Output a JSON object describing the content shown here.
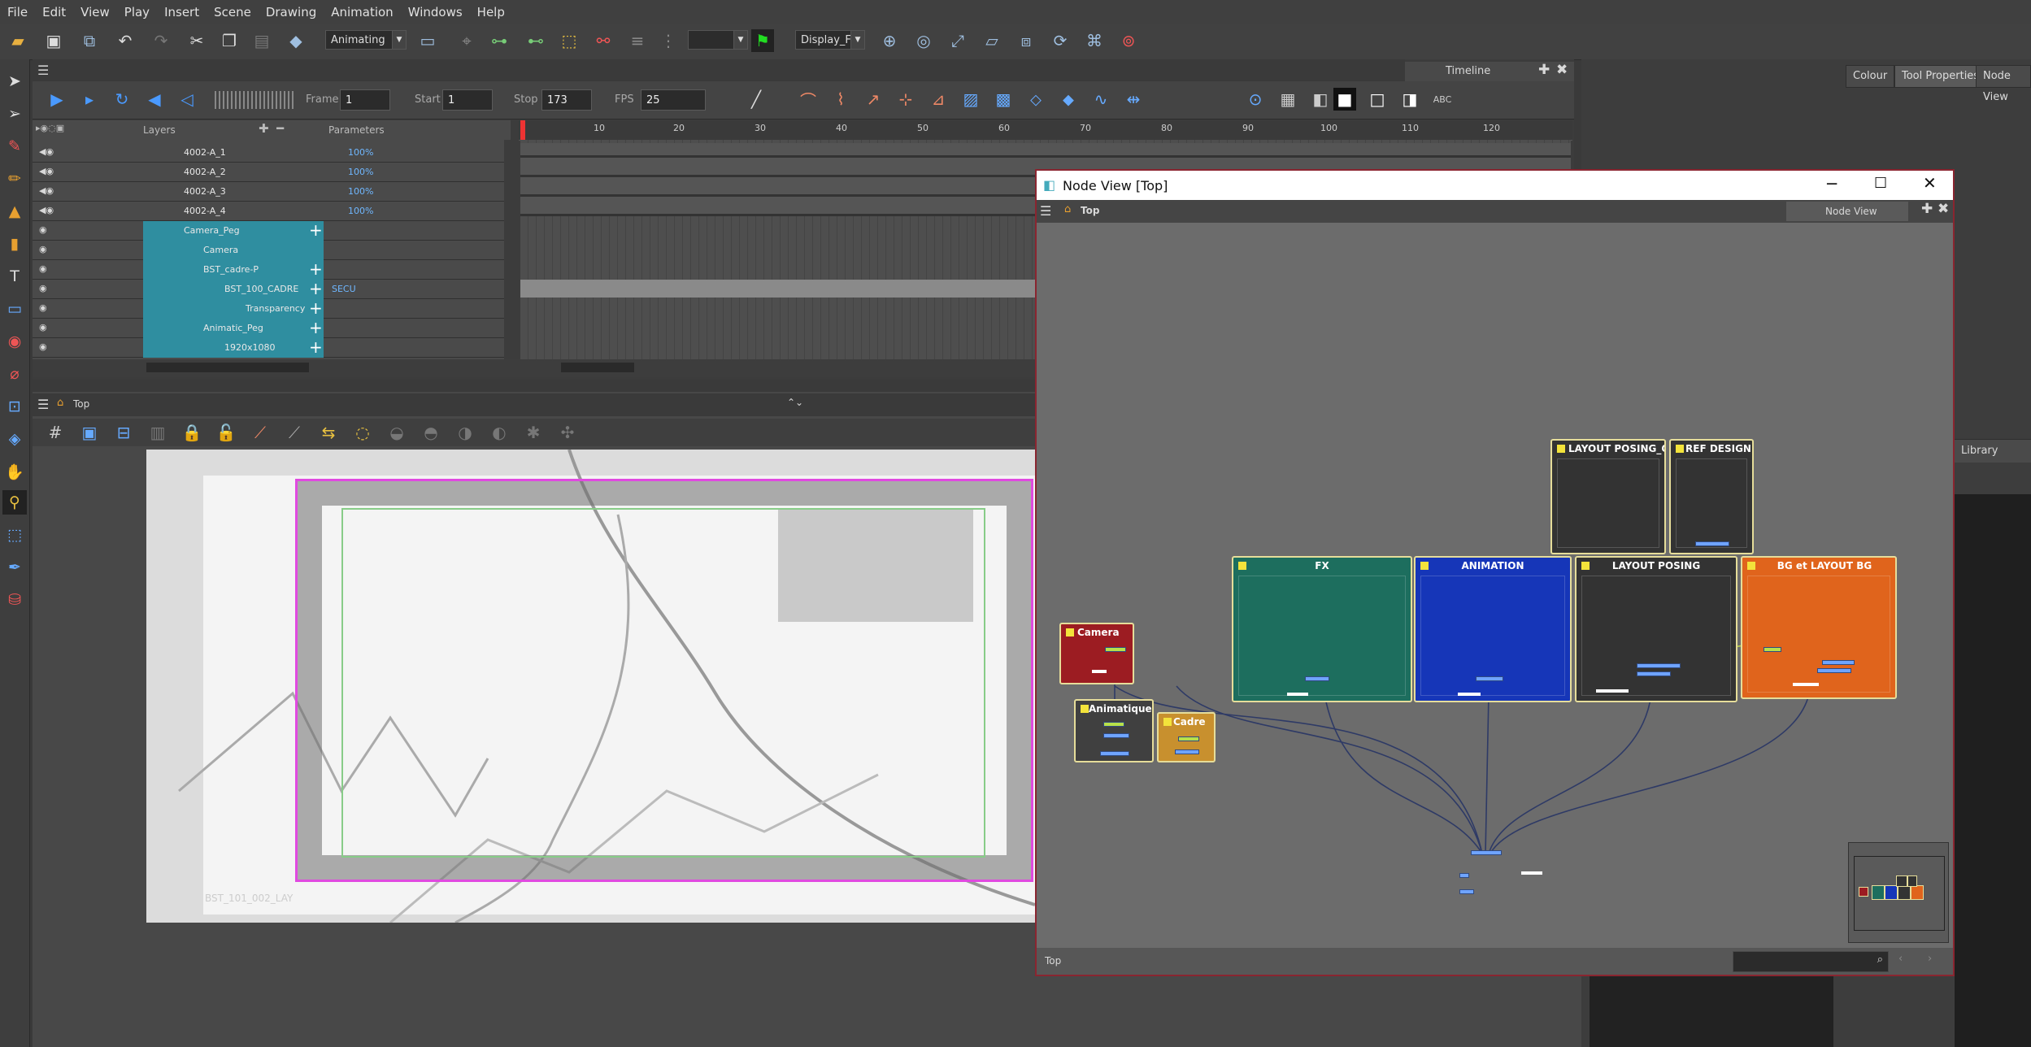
{
  "menu": [
    "File",
    "Edit",
    "View",
    "Play",
    "Insert",
    "Scene",
    "Drawing",
    "Animation",
    "Windows",
    "Help"
  ],
  "toolbar": {
    "mode_combo": "Animating",
    "display_combo": "Display_Fir"
  },
  "timeline": {
    "tab": "Timeline",
    "frame_label": "Frame",
    "frame_value": "1",
    "start_label": "Start",
    "start_value": "1",
    "stop_label": "Stop",
    "stop_value": "173",
    "fps_label": "FPS",
    "fps_value": "25",
    "layers_label": "Layers",
    "params_label": "Parameters",
    "ruler": [
      "10",
      "20",
      "30",
      "40",
      "50",
      "60",
      "70",
      "80",
      "90",
      "100",
      "110",
      "120"
    ],
    "layers": [
      {
        "name": "4002-A_1",
        "pct": "100%"
      },
      {
        "name": "4002-A_2",
        "pct": "100%"
      },
      {
        "name": "4002-A_3",
        "pct": "100%"
      },
      {
        "name": "4002-A_4",
        "pct": "100%"
      },
      {
        "name": "Camera_Peg",
        "pct": ""
      },
      {
        "name": "Camera",
        "pct": ""
      },
      {
        "name": "BST_cadre-P",
        "pct": ""
      },
      {
        "name": "BST_100_CADRE",
        "pct": "SECU"
      },
      {
        "name": "Transparency",
        "pct": ""
      },
      {
        "name": "Animatic_Peg",
        "pct": ""
      },
      {
        "name": "1920x1080",
        "pct": ""
      }
    ]
  },
  "camera_view": {
    "breadcrumb": "Top",
    "watermark": "BST_101_002_LAY"
  },
  "node_view": {
    "title": "Node View [Top]",
    "breadcrumb": "Top",
    "tab": "Node View",
    "status": "Top",
    "nodes": {
      "camera": "Camera",
      "animatique": "Animatique",
      "cadre": "Cadre",
      "fx": "FX",
      "animation": "ANIMATION",
      "layout_posing": "LAYOUT POSING",
      "bg": "BG et LAYOUT BG",
      "layout_old": "LAYOUT POSING_OLD",
      "ref": "REF DESIGN"
    }
  },
  "right_tabs": [
    "Colour",
    "Tool Properties",
    "Node View"
  ],
  "library_label": "Library"
}
